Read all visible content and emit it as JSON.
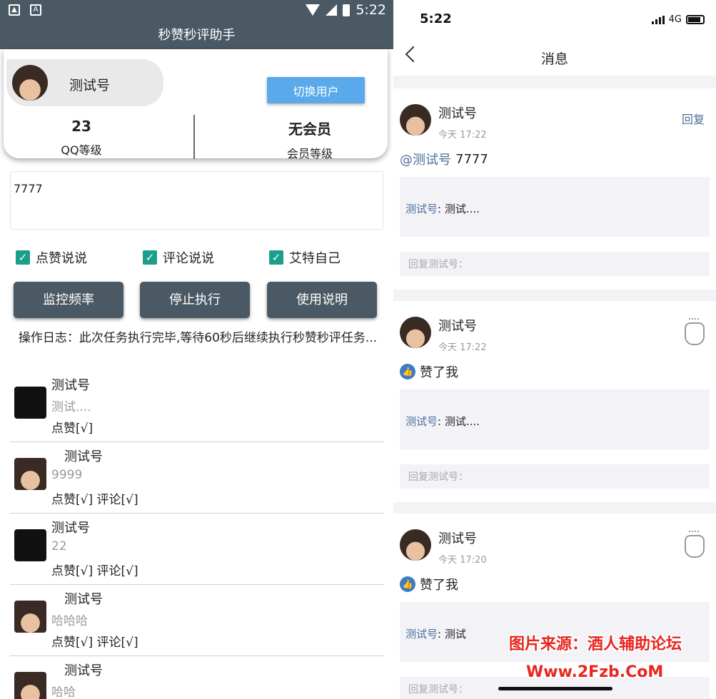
{
  "left": {
    "status_time": "5:22",
    "app_title": "秒赞秒评助手",
    "user": {
      "name": "测试号",
      "switch_label": "切换用户"
    },
    "stats": [
      {
        "value": "23",
        "label": "QQ等级"
      },
      {
        "value": "无会员",
        "label": "会员等级"
      }
    ],
    "input_value": "7777",
    "checkboxes": [
      "点赞说说",
      "评论说说",
      "艾特自己"
    ],
    "buttons": [
      "监控频率",
      "停止执行",
      "使用说明"
    ],
    "log": "操作日志：此次任务执行完毕,等待60秒后继续执行秒赞秒评任务...",
    "feed": [
      {
        "name": "测试号",
        "content": "测试....",
        "status": "点赞[√]"
      },
      {
        "name": "测试号",
        "content": "9999",
        "status": "点赞[√] 评论[√]"
      },
      {
        "name": "测试号",
        "content": "22",
        "status": "点赞[√] 评论[√]"
      },
      {
        "name": "测试号",
        "content": "哈哈哈",
        "status": "点赞[√] 评论[√]"
      },
      {
        "name": "测试号",
        "content": "哈哈",
        "status": ""
      }
    ]
  },
  "right": {
    "status_time": "5:22",
    "network": "4G",
    "title": "消息",
    "messages": [
      {
        "name": "测试号",
        "time": "今天 17:22",
        "reply_label": "回复",
        "mention": "@测试号",
        "text": "7777",
        "quote_name": "测试号",
        "quote_text": ": 测试....",
        "reply_placeholder": "回复测试号："
      },
      {
        "name": "测试号",
        "time": "今天 17:22",
        "text": "赞了我",
        "quote_name": "测试号",
        "quote_text": ": 测试....",
        "reply_placeholder": "回复测试号："
      },
      {
        "name": "测试号",
        "time": "今天 17:20",
        "text": "赞了我",
        "quote_name": "测试号",
        "quote_text": ": 测试",
        "reply_placeholder": "回复测试号："
      }
    ]
  },
  "watermark": {
    "line1": "图片来源：酒人辅助论坛",
    "line2": "Www.2Fzb.CoM"
  },
  "colors": {
    "app_bar": "#4a5964",
    "switch_button": "#5aa9ea",
    "checkbox": "#1a9f8b",
    "link": "#4a6f9a",
    "like_badge": "#3f7ac4"
  }
}
